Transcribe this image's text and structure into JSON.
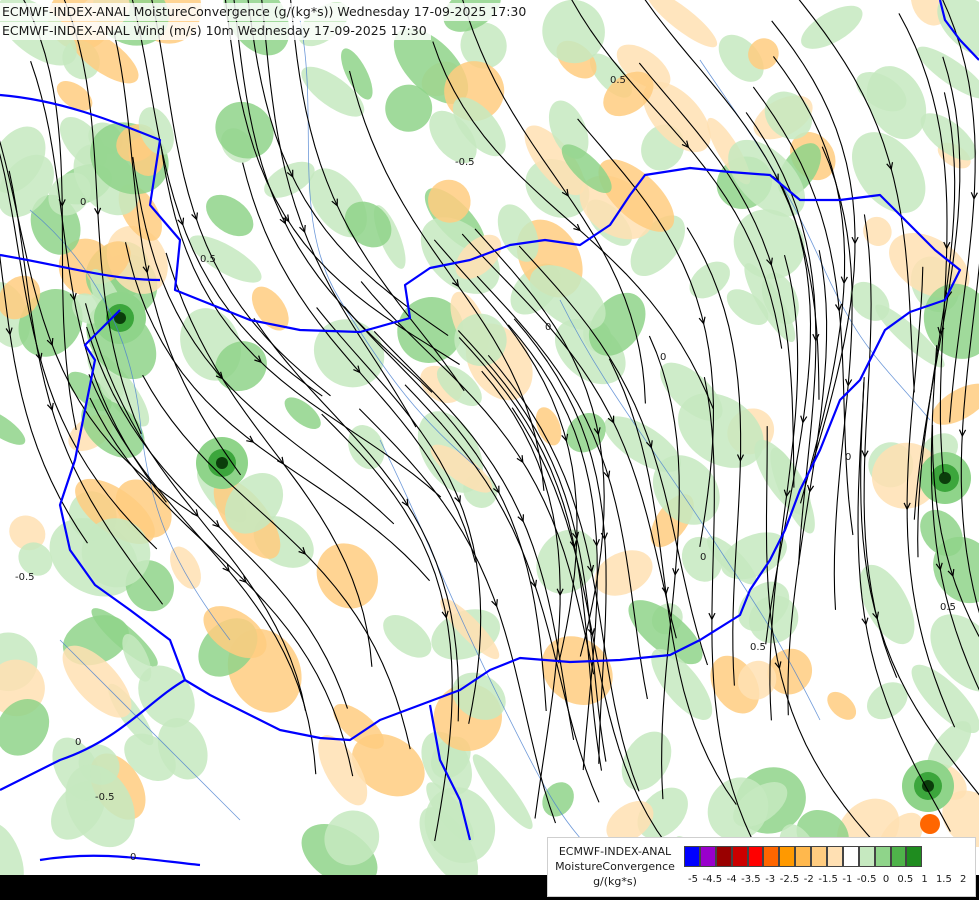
{
  "titles": {
    "line1": "ECMWF-INDEX-ANAL MoistureConvergence (g/(kg*s)) Wednesday 17-09-2025 17:30",
    "line2": "ECMWF-INDEX-ANAL Wind (m/s) 10m Wednesday 17-09-2025 17:30"
  },
  "legend": {
    "line1": "ECMWF-INDEX-ANAL",
    "line2": "MoistureConvergence",
    "line3": "g/(kg*s)",
    "levels": [
      "-5",
      "-4.5",
      "-4",
      "-3.5",
      "-3",
      "-2.5",
      "-2",
      "-1.5",
      "-1",
      "-0.5",
      "0",
      "0.5",
      "1",
      "1.5",
      "2"
    ],
    "colors": [
      "#0000ff",
      "#9900cc",
      "#990000",
      "#cc0000",
      "#ff0000",
      "#ff6600",
      "#ff9900",
      "#ffb84d",
      "#ffcc80",
      "#ffe0b3",
      "#ffffff",
      "#c6e9c0",
      "#8fd48a",
      "#4fb34a",
      "#1f8c1f"
    ]
  },
  "contour_labels": [
    "0",
    "0.5",
    "-0.5",
    "0",
    "0.5",
    "0",
    "-0.5",
    "0",
    "0.5",
    "0",
    "-0.5",
    "0",
    "0.5",
    "0"
  ],
  "colors": {
    "border": "#0000ff",
    "river": "#4a7fd0",
    "streamline": "#000000",
    "convergence_light": "#c6e9c0",
    "convergence_mid": "#8fd48a",
    "convergence_strong": "#3ca63c",
    "divergence_light": "#ffe0b3",
    "divergence_mid": "#ffcc80"
  }
}
